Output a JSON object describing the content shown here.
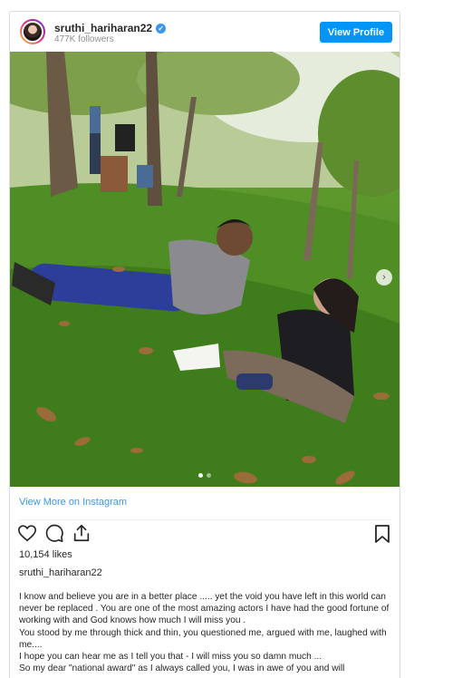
{
  "header": {
    "username": "sruthi_hariharan22",
    "followers": "477K followers",
    "view_profile_label": "View Profile",
    "verified_icon": "verified-badge-icon"
  },
  "colors": {
    "accent": "#0095f6",
    "link": "#3897f0",
    "border": "#dbdbdb"
  },
  "post": {
    "view_more_label": "View More on Instagram",
    "likes": "10,154 likes",
    "username": "sruthi_hariharan22",
    "caption": "I know and believe you are in a better place ..... yet the void you have left in this world can never be replaced . You are one of the most amazing actors I have had the good fortune of working with and God knows how much I will miss you .\nYou stood by me through thick and thin, you questioned me, argued with me, laughed with me....\nI hope you can hear me as I tell you that - I will miss you so damn much ...\nSo my dear \"national award\" as I always called you, I was in awe of you and will",
    "actions": [
      "heart-icon",
      "comment-icon",
      "share-icon",
      "bookmark-icon"
    ],
    "carousel": {
      "slides": 2,
      "current": 1
    }
  }
}
